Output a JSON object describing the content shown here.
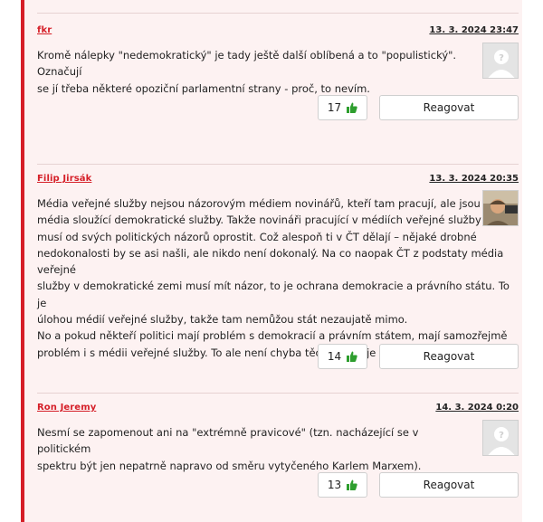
{
  "comments": [
    {
      "author": "fkr",
      "date": "13. 3. 2024 23:47",
      "text": "Kromě nálepky \"nedemokratický\" je tady ještě další oblíbená a to \"populistický\". Označují\nse jí třeba některé opoziční parlamentní strany - proč, to nevím.",
      "likes": "17",
      "reply_label": "Reagovat",
      "avatar": "placeholder-avatar-icon"
    },
    {
      "author": "Filip Jirsák",
      "date": "13. 3. 2024 20:35",
      "text": "Média veřejné služby nejsou názorovým médiem novinářů, kteří tam pracují, ale jsou to\nmédia sloužící demokratické služby. Takže novináři pracující v médiích veřejné služby se\nmusí od svých politických názorů oprostit. Což alespoň ti v ČT dělají – nějaké drobné\nnedokonalosti by se asi našli, ale nikdo není dokonalý. Na co naopak ČT z podstaty média veřejné\nslužby v demokratické zemi musí mít názor, to je ochrana demokracie a právního státu. To je\núlohou médií veřejné služby, takže tam nemůžou stát nezaujatě mimo.\nNo a pokud někteří politici mají problém s demokracií a právním státem, mají samozřejmě\nproblém i s médii veřejné služby. To ale není chyba těch médií, je to chyba těch politiků.",
      "likes": "14",
      "reply_label": "Reagovat",
      "avatar": "user-photo"
    },
    {
      "author": "Ron Jeremy",
      "date": "14. 3. 2024 0:20",
      "text": "Nesmí se zapomenout ani na \"extrémně pravicové\" (tzn. nacházející se v politickém\nspektru být jen nepatrně napravo od směru vytyčeného Karlem Marxem).",
      "likes": "13",
      "reply_label": "Reagovat",
      "avatar": "placeholder-avatar-icon"
    }
  ],
  "colors": {
    "accent": "#d51f28",
    "background": "#fdf2f2",
    "like": "#2e9e2e"
  }
}
